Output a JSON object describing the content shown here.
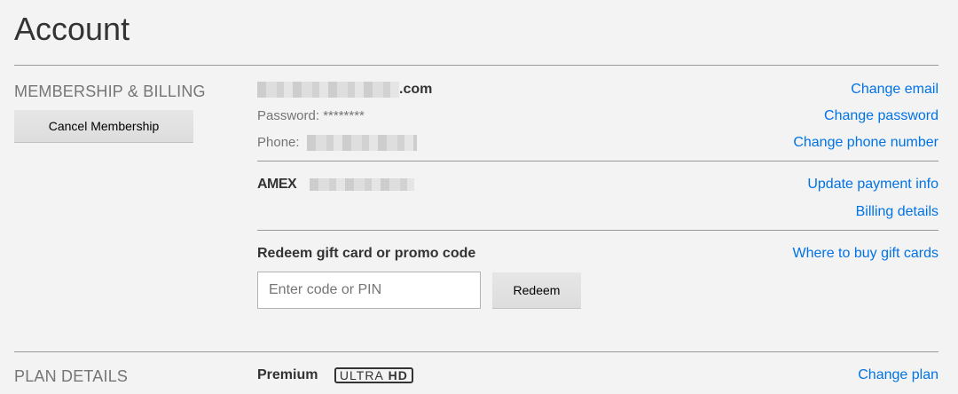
{
  "page": {
    "title": "Account"
  },
  "membership": {
    "section_label": "MEMBERSHIP & BILLING",
    "cancel_button": "Cancel Membership",
    "email_suffix": ".com",
    "password_label": "Password: ********",
    "phone_label": "Phone:",
    "links": {
      "change_email": "Change email",
      "change_password": "Change password",
      "change_phone": "Change phone number",
      "update_payment": "Update payment info",
      "billing_details": "Billing details",
      "where_to_buy": "Where to buy gift cards"
    },
    "payment_brand": "AMEX",
    "redeem": {
      "heading": "Redeem gift card or promo code",
      "placeholder": "Enter code or PIN",
      "button": "Redeem"
    }
  },
  "plan": {
    "section_label": "PLAN DETAILS",
    "plan_name": "Premium",
    "badge_text": "ULTRA",
    "badge_bold": "HD",
    "change_plan": "Change plan"
  },
  "colors": {
    "link": "#0073e6",
    "background": "#f3f3f3",
    "text": "#333333",
    "muted": "#757575"
  }
}
